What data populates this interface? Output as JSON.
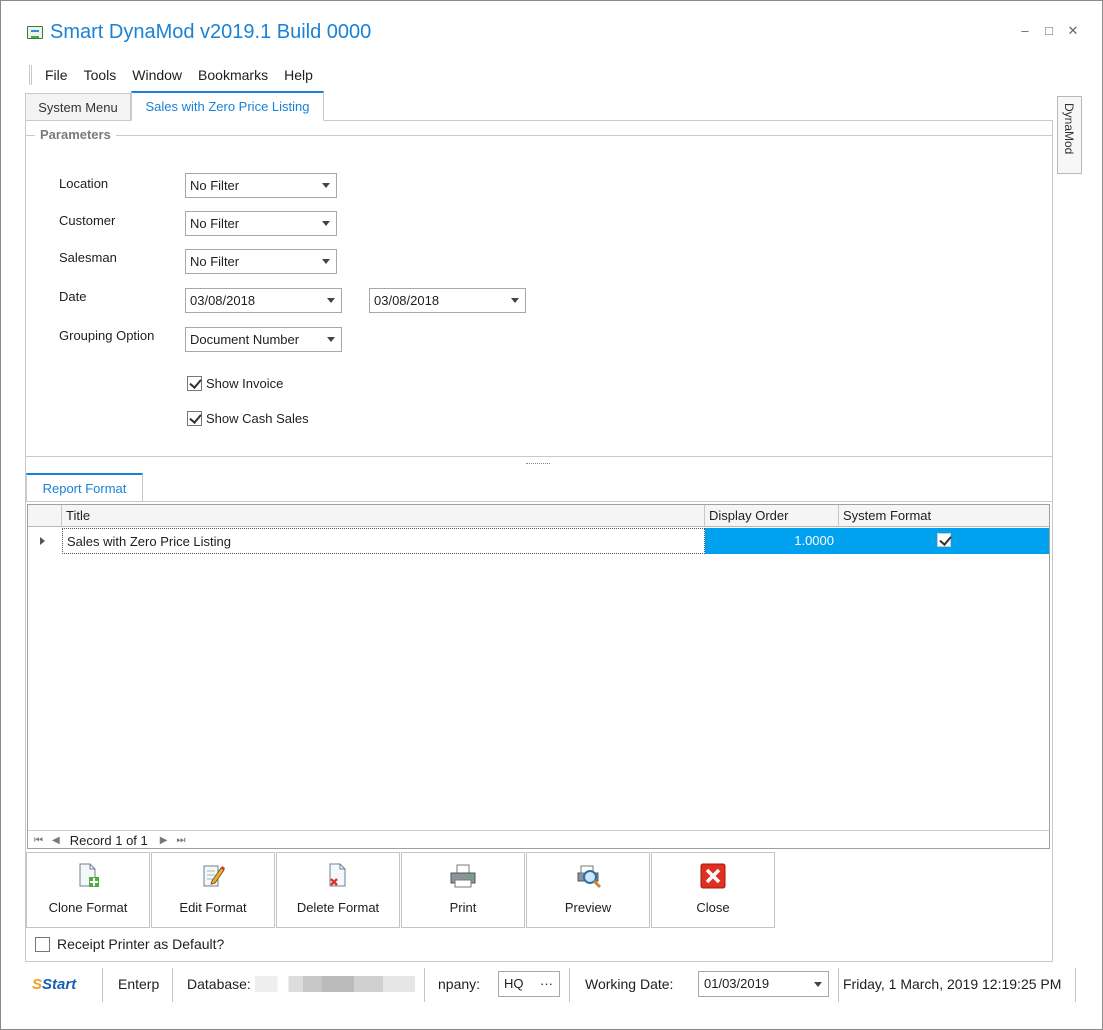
{
  "window": {
    "title": "Smart DynaMod v2019.1 Build 0000",
    "controls": {
      "minimize": "–",
      "maximize": "□",
      "close": "✕"
    }
  },
  "menu": {
    "items": [
      "File",
      "Tools",
      "Window",
      "Bookmarks",
      "Help"
    ]
  },
  "tabs": [
    {
      "label": "System Menu",
      "active": false
    },
    {
      "label": "Sales with Zero Price Listing",
      "active": true
    }
  ],
  "side_tab": {
    "label": "DynaMod"
  },
  "parameters": {
    "group_title": "Parameters",
    "location": {
      "label": "Location",
      "value": "No Filter"
    },
    "customer": {
      "label": "Customer",
      "value": "No Filter"
    },
    "salesman": {
      "label": "Salesman",
      "value": "No Filter"
    },
    "date": {
      "label": "Date",
      "from": "03/08/2018",
      "to": "03/08/2018"
    },
    "grouping": {
      "label": "Grouping Option",
      "value": "Document Number"
    },
    "show_invoice": {
      "label": "Show Invoice",
      "checked": true
    },
    "show_cash_sales": {
      "label": "Show Cash Sales",
      "checked": true
    }
  },
  "report_format": {
    "tab_label": "Report Format",
    "columns": [
      "Title",
      "Display Order",
      "System Format"
    ],
    "rows": [
      {
        "title": "Sales with Zero Price Listing",
        "display_order": "1.0000",
        "system_format": true
      }
    ],
    "navigator": "Record 1 of 1",
    "selection_color": "#00a2f0"
  },
  "toolbar": {
    "clone": "Clone Format",
    "edit": "Edit Format",
    "delete": "Delete Format",
    "print": "Print",
    "preview": "Preview",
    "close": "Close"
  },
  "receipt_printer": {
    "label": "Receipt Printer as Default?",
    "checked": false
  },
  "status": {
    "logo": "Start",
    "edition": "Enterp",
    "database_label": "Database:",
    "company_label": "npany:",
    "company_value": "HQ",
    "working_date_label": "Working Date:",
    "working_date_value": "01/03/2019",
    "datetime": "Friday, 1 March, 2019 12:19:25 PM"
  },
  "colors": {
    "accent": "#1a82d6",
    "selection": "#00a2f0"
  }
}
